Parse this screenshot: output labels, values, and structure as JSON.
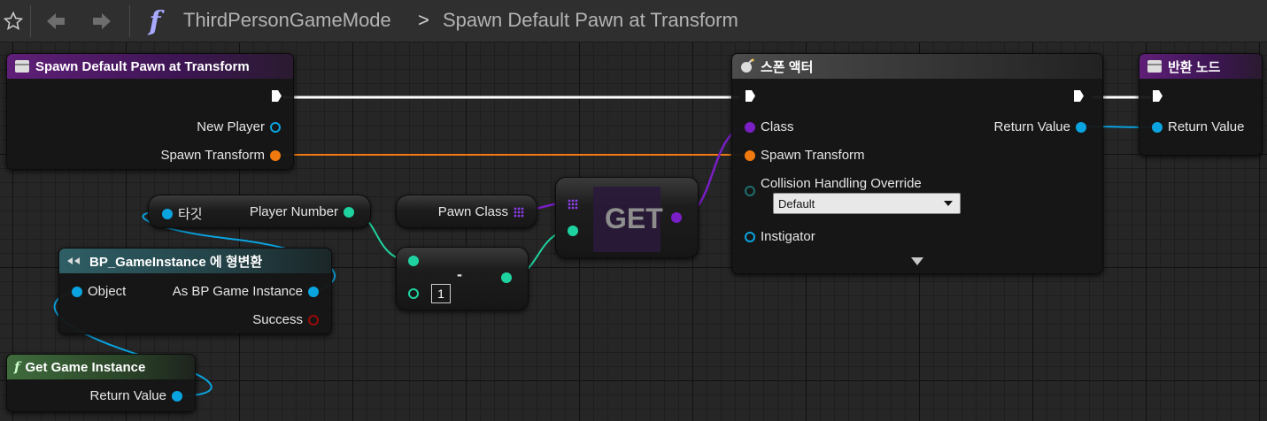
{
  "toolbar": {
    "breadcrumb_root": "ThirdPersonGameMode",
    "breadcrumb_sep": ">",
    "breadcrumb_current": "Spawn Default Pawn at Transform",
    "function_glyph": "f"
  },
  "nodes": {
    "entry": {
      "title": "Spawn Default Pawn at Transform",
      "pins": {
        "new_player": "New Player",
        "spawn_transform": "Spawn Transform"
      }
    },
    "spawn_actor": {
      "title": "스폰 액터",
      "pins": {
        "class": "Class",
        "spawn_transform": "Spawn Transform",
        "collision": "Collision Handling Override",
        "collision_value": "Default",
        "instigator": "Instigator",
        "return_value": "Return Value"
      }
    },
    "return_node": {
      "title": "반환 노드",
      "pins": {
        "return_value": "Return Value"
      }
    },
    "target_var": {
      "target": "타깃",
      "player_number": "Player Number"
    },
    "pawn_class_var": {
      "label": "Pawn Class"
    },
    "get_node": {
      "label": "GET"
    },
    "subtract_node": {
      "input_value": "1",
      "operator": "-"
    },
    "cast_node": {
      "title": "BP_GameInstance 에 형변환",
      "pins": {
        "object": "Object",
        "as_bp": "As BP Game Instance",
        "success": "Success"
      }
    },
    "get_game_instance": {
      "title": "Get Game Instance",
      "pins": {
        "return_value": "Return Value"
      }
    }
  },
  "colors": {
    "exec": "#ffffff",
    "object": "#0aa4e0",
    "transform": "#f07a10",
    "class": "#7a1ec6",
    "integer": "#1fd3a0"
  }
}
